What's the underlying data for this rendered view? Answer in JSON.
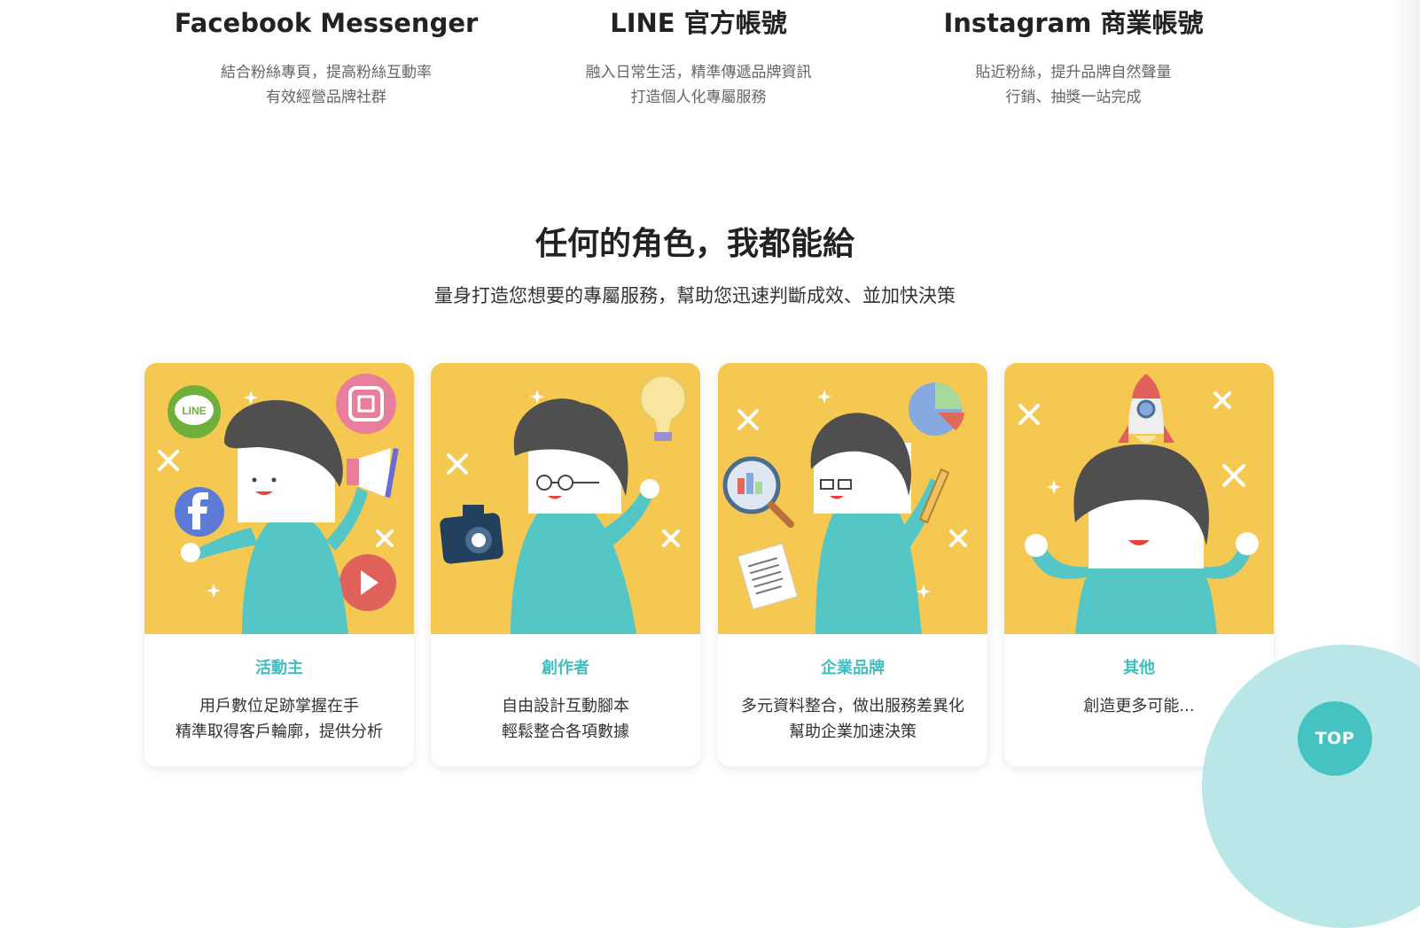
{
  "platforms": [
    {
      "title": "Facebook Messenger",
      "lines": [
        "結合粉絲專頁，提高粉絲互動率",
        "有效經營品牌社群"
      ]
    },
    {
      "title": "LINE 官方帳號",
      "lines": [
        "融入日常生活，精準傳遞品牌資訊",
        "打造個人化專屬服務"
      ]
    },
    {
      "title": "Instagram 商業帳號",
      "lines": [
        "貼近粉絲，提升品牌自然聲量",
        "行銷、抽獎一站完成"
      ]
    }
  ],
  "section": {
    "title": "任何的角色，我都能給",
    "subtitle": "量身打造您想要的專屬服務，幫助您迅速判斷成效、並加快決策"
  },
  "roles": [
    {
      "name": "活動主",
      "lines": [
        "用戶數位足跡掌握在手",
        "精準取得客戶輪廓，提供分析"
      ]
    },
    {
      "name": "創作者",
      "lines": [
        "自由設計互動腳本",
        "輕鬆整合各項數據"
      ]
    },
    {
      "name": "企業品牌",
      "lines": [
        "多元資料整合，做出服務差異化",
        "幫助企業加速決策"
      ]
    },
    {
      "name": "其他",
      "lines": [
        "創造更多可能..."
      ]
    }
  ],
  "badges": {
    "line_logo": "LINE"
  },
  "top_button": "TOP",
  "colors": {
    "card_bg": "#f5c852",
    "teal": "#55c6c6",
    "accent": "#3fbfbf",
    "hair": "#4f4f4f"
  }
}
